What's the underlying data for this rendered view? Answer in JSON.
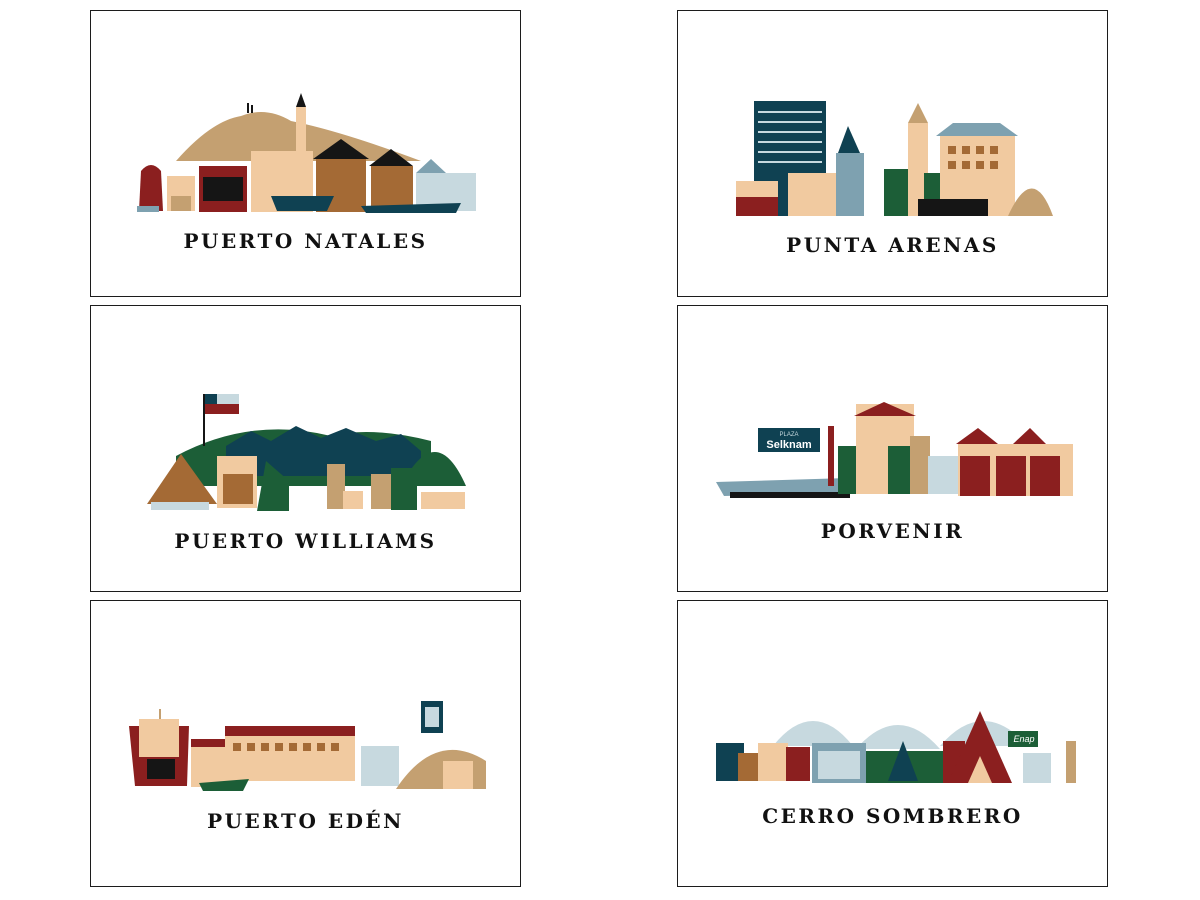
{
  "palette": {
    "sand": "#c4a071",
    "peach": "#f1caa0",
    "brown": "#a46a35",
    "maroon": "#8b1f1f",
    "navy": "#0f4152",
    "slate": "#7ea1b0",
    "pale": "#c7d9df",
    "green": "#1c5e37",
    "black": "#151515"
  },
  "cards": [
    {
      "title": "PUERTO NATALES"
    },
    {
      "title": "PUNTA ARENAS"
    },
    {
      "title": "PUERTO WILLIAMS"
    },
    {
      "title": "PORVENIR"
    },
    {
      "title": "PUERTO EDÉN"
    },
    {
      "title": "CERRO SOMBRERO"
    }
  ],
  "signage": {
    "plaza": "PLAZA",
    "selknam": "Selknam",
    "enap": "Enap"
  }
}
